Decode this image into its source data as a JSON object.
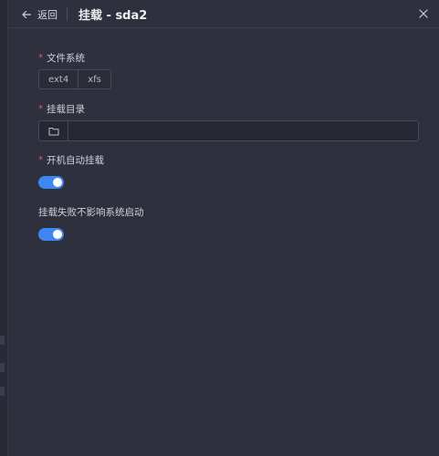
{
  "header": {
    "back_label": "返回",
    "title": "挂载 - sda2"
  },
  "form": {
    "filesystem": {
      "label": "文件系统",
      "required": "*",
      "options": [
        "ext4",
        "xfs"
      ]
    },
    "mount_dir": {
      "label": "挂载目录",
      "required": "*",
      "value": "",
      "placeholder": ""
    },
    "auto_mount": {
      "label": "开机自动挂载",
      "required": "*",
      "enabled": true
    },
    "ignore_failure": {
      "label": "挂载失败不影响系统启动",
      "enabled": true
    }
  },
  "colors": {
    "accent": "#3e87f0",
    "required": "#e0576a",
    "background": "#2e303d"
  },
  "icons": {
    "back": "arrow-left-icon",
    "close": "close-icon",
    "folder": "folder-icon"
  }
}
